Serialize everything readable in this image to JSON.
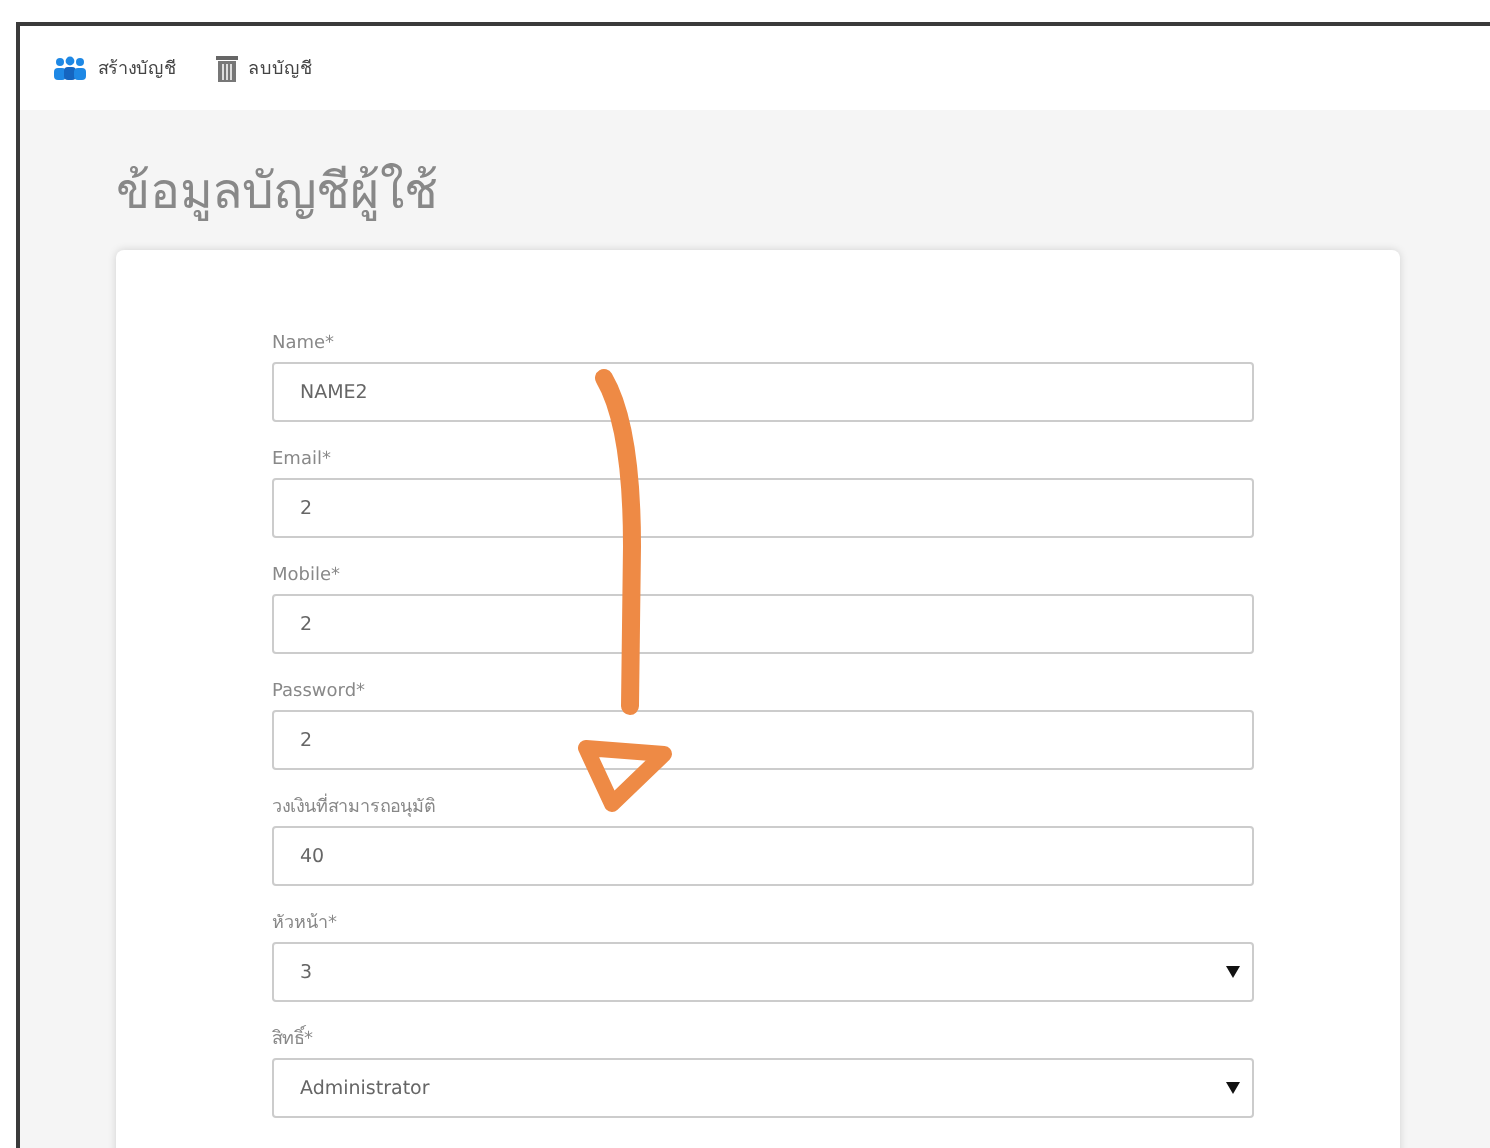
{
  "toolbar": [
    {
      "kind": "users",
      "label": "สร้างบัญชี"
    },
    {
      "kind": "trash",
      "label": "ลบบัญชี"
    }
  ],
  "title": "ข้อมูลบัญชีผู้ใช้",
  "fields": [
    {
      "kind": "text",
      "label": "Name*",
      "value": "NAME2"
    },
    {
      "kind": "text",
      "label": "Email*",
      "value": "2"
    },
    {
      "kind": "text",
      "label": "Mobile*",
      "value": "2"
    },
    {
      "kind": "text",
      "label": "Password*",
      "value": "2"
    },
    {
      "kind": "text",
      "label": "วงเงินที่สามารถอนุมัติ",
      "value": "40"
    },
    {
      "kind": "select",
      "label": "หัวหน้า*",
      "value": "3"
    },
    {
      "kind": "select",
      "label": "สิทธิ์*",
      "value": "Administrator"
    }
  ]
}
